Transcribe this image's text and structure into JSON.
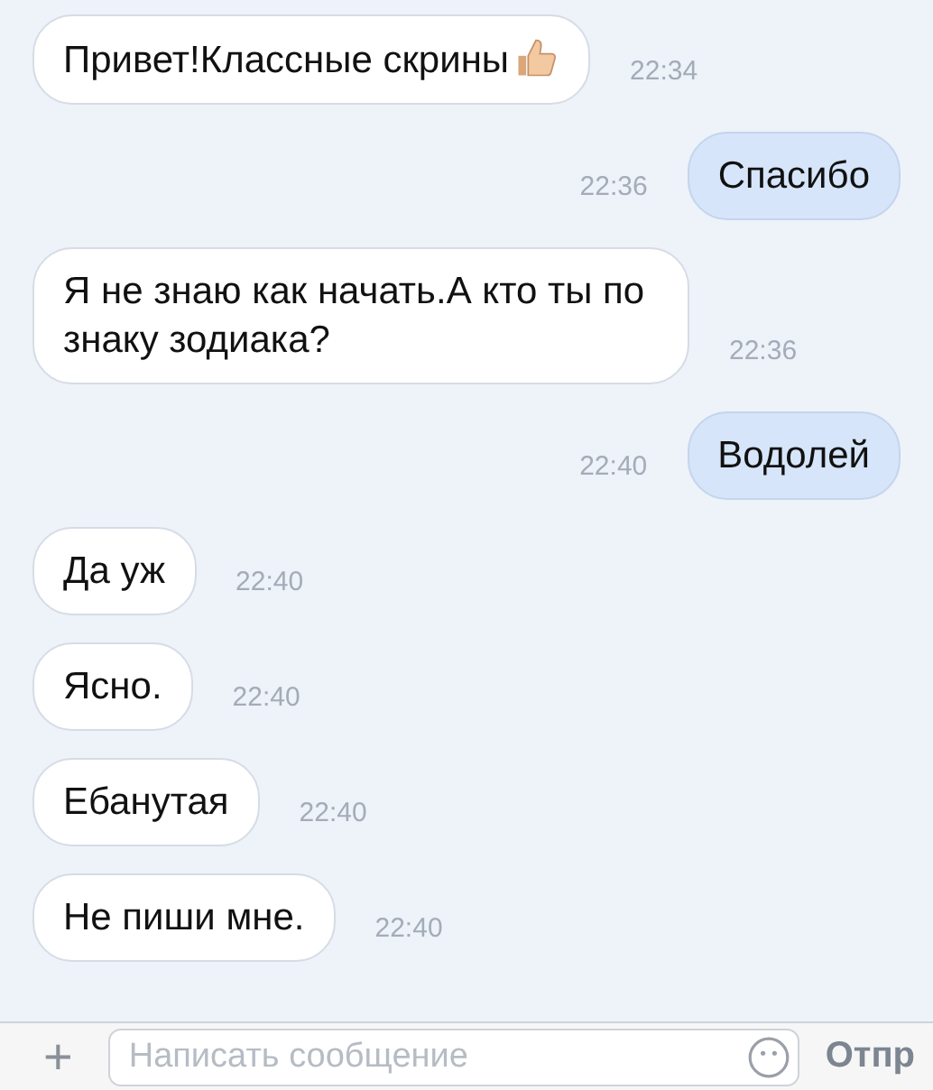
{
  "messages": [
    {
      "kind": "in",
      "text": "Привет!Классные скрины",
      "thumbs_up": true,
      "time": "22:34"
    },
    {
      "kind": "out",
      "text": "Спасибо",
      "thumbs_up": false,
      "time": "22:36"
    },
    {
      "kind": "in",
      "text": "Я не знаю как начать.А кто ты по знаку зодиака?",
      "thumbs_up": false,
      "time": "22:36"
    },
    {
      "kind": "out",
      "text": "Водолей",
      "thumbs_up": false,
      "time": "22:40"
    },
    {
      "kind": "in",
      "text": "Да уж",
      "thumbs_up": false,
      "time": "22:40"
    },
    {
      "kind": "in",
      "text": "Ясно.",
      "thumbs_up": false,
      "time": "22:40"
    },
    {
      "kind": "in",
      "text": "Ебанутая",
      "thumbs_up": false,
      "time": "22:40"
    },
    {
      "kind": "in",
      "text": "Не пиши мне.",
      "thumbs_up": false,
      "time": "22:40"
    }
  ],
  "composer": {
    "add": "+",
    "placeholder": "Написать сообщение",
    "send": "Отпр"
  }
}
